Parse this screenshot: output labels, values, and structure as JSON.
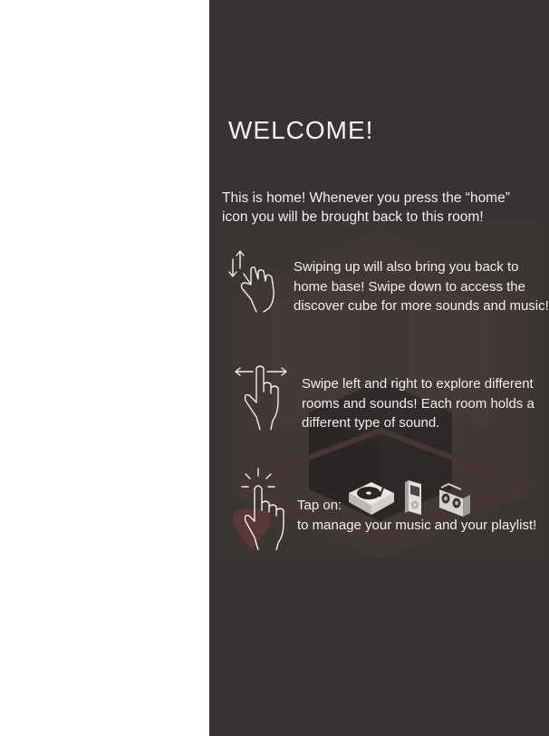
{
  "welcome": {
    "title": "WELCOME!",
    "intro": "This is home! Whenever you press the “home” icon you will be brought back to this room!"
  },
  "instructions": [
    {
      "icon": "swipe-up-down-hand-icon",
      "text": "Swiping up will also bring you back to home base! Swipe down to access the discover cube for more sounds and music!"
    },
    {
      "icon": "swipe-left-right-hand-icon",
      "text": "Swipe left and right to explore different rooms and sounds! Each room holds a different type of sound."
    },
    {
      "icon": "tap-hand-icon",
      "label": "Tap on:",
      "text": "to manage your music and your playlist!"
    }
  ],
  "tap_items": [
    "turntable-icon",
    "ipod-icon",
    "boombox-icon"
  ],
  "colors": {
    "panel_background": "#373332",
    "text": "#f2efee",
    "room_accent": "#5a3836"
  }
}
